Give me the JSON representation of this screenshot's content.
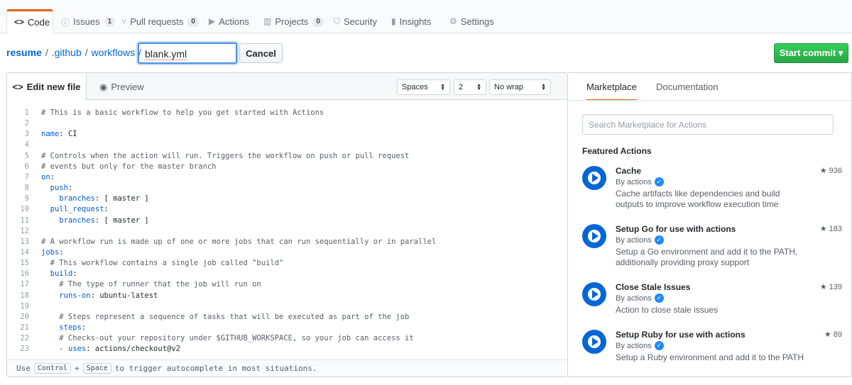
{
  "repo_nav": {
    "tabs": [
      {
        "label": "Code",
        "icon": "code-icon",
        "count": ""
      },
      {
        "label": "Issues",
        "icon": "issue-icon",
        "count": "1"
      },
      {
        "label": "Pull requests",
        "icon": "pull-request-icon",
        "count": "0"
      },
      {
        "label": "Actions",
        "icon": "play-icon",
        "count": ""
      },
      {
        "label": "Projects",
        "icon": "project-icon",
        "count": "0"
      },
      {
        "label": "Security",
        "icon": "shield-icon",
        "count": ""
      },
      {
        "label": "Insights",
        "icon": "graph-icon",
        "count": ""
      },
      {
        "label": "Settings",
        "icon": "gear-icon",
        "count": ""
      }
    ]
  },
  "breadcrumb": {
    "repo": "resume",
    "dir1": ".github",
    "dir2": "workflows",
    "sep": "/"
  },
  "filename_input": {
    "value": "blank.yml"
  },
  "buttons": {
    "cancel": "Cancel",
    "commit": "Start commit ▾"
  },
  "editor": {
    "tab_edit": "Edit new file",
    "tab_preview": "Preview",
    "indent_mode": "Spaces",
    "indent_size": "2",
    "wrap_mode": "No wrap",
    "lines": [
      "# This is a basic workflow to help you get started with Actions",
      "",
      "name: CI",
      "",
      "# Controls when the action will run. Triggers the workflow on push or pull request",
      "# events but only for the master branch",
      "on:",
      "  push:",
      "    branches: [ master ]",
      "  pull_request:",
      "    branches: [ master ]",
      "",
      "# A workflow run is made up of one or more jobs that can run sequentially or in parallel",
      "jobs:",
      "  # This workflow contains a single job called \"build\"",
      "  build:",
      "    # The type of runner that the job will run on",
      "    runs-on: ubuntu-latest",
      "",
      "    # Steps represent a sequence of tasks that will be executed as part of the job",
      "    steps:",
      "    # Checks-out your repository under $GITHUB_WORKSPACE, so your job can access it",
      "    - uses: actions/checkout@v2"
    ],
    "footer_use": "Use",
    "footer_key1": "Control",
    "footer_plus": "+",
    "footer_key2": "Space",
    "footer_rest": "to trigger autocomplete in most situations."
  },
  "sidebar": {
    "tab_marketplace": "Marketplace",
    "tab_docs": "Documentation",
    "search_placeholder": "Search Marketplace for Actions",
    "featured_title": "Featured Actions",
    "items": [
      {
        "name": "Cache",
        "by": "By actions",
        "desc": "Cache artifacts like dependencies and build outputs to improve workflow execution time",
        "stars": "936"
      },
      {
        "name": "Setup Go for use with actions",
        "by": "By actions",
        "desc": "Setup a Go environment and add it to the PATH, additionally providing proxy support",
        "stars": "183"
      },
      {
        "name": "Close Stale Issues",
        "by": "By actions",
        "desc": "Action to close stale issues",
        "stars": "139"
      },
      {
        "name": "Setup Ruby for use with actions",
        "by": "By actions",
        "desc": "Setup a Ruby environment and add it to the PATH",
        "stars": "89"
      }
    ]
  },
  "colors": {
    "accent": "#e36209",
    "link": "#0366d6",
    "commit_green": "#28a745"
  }
}
